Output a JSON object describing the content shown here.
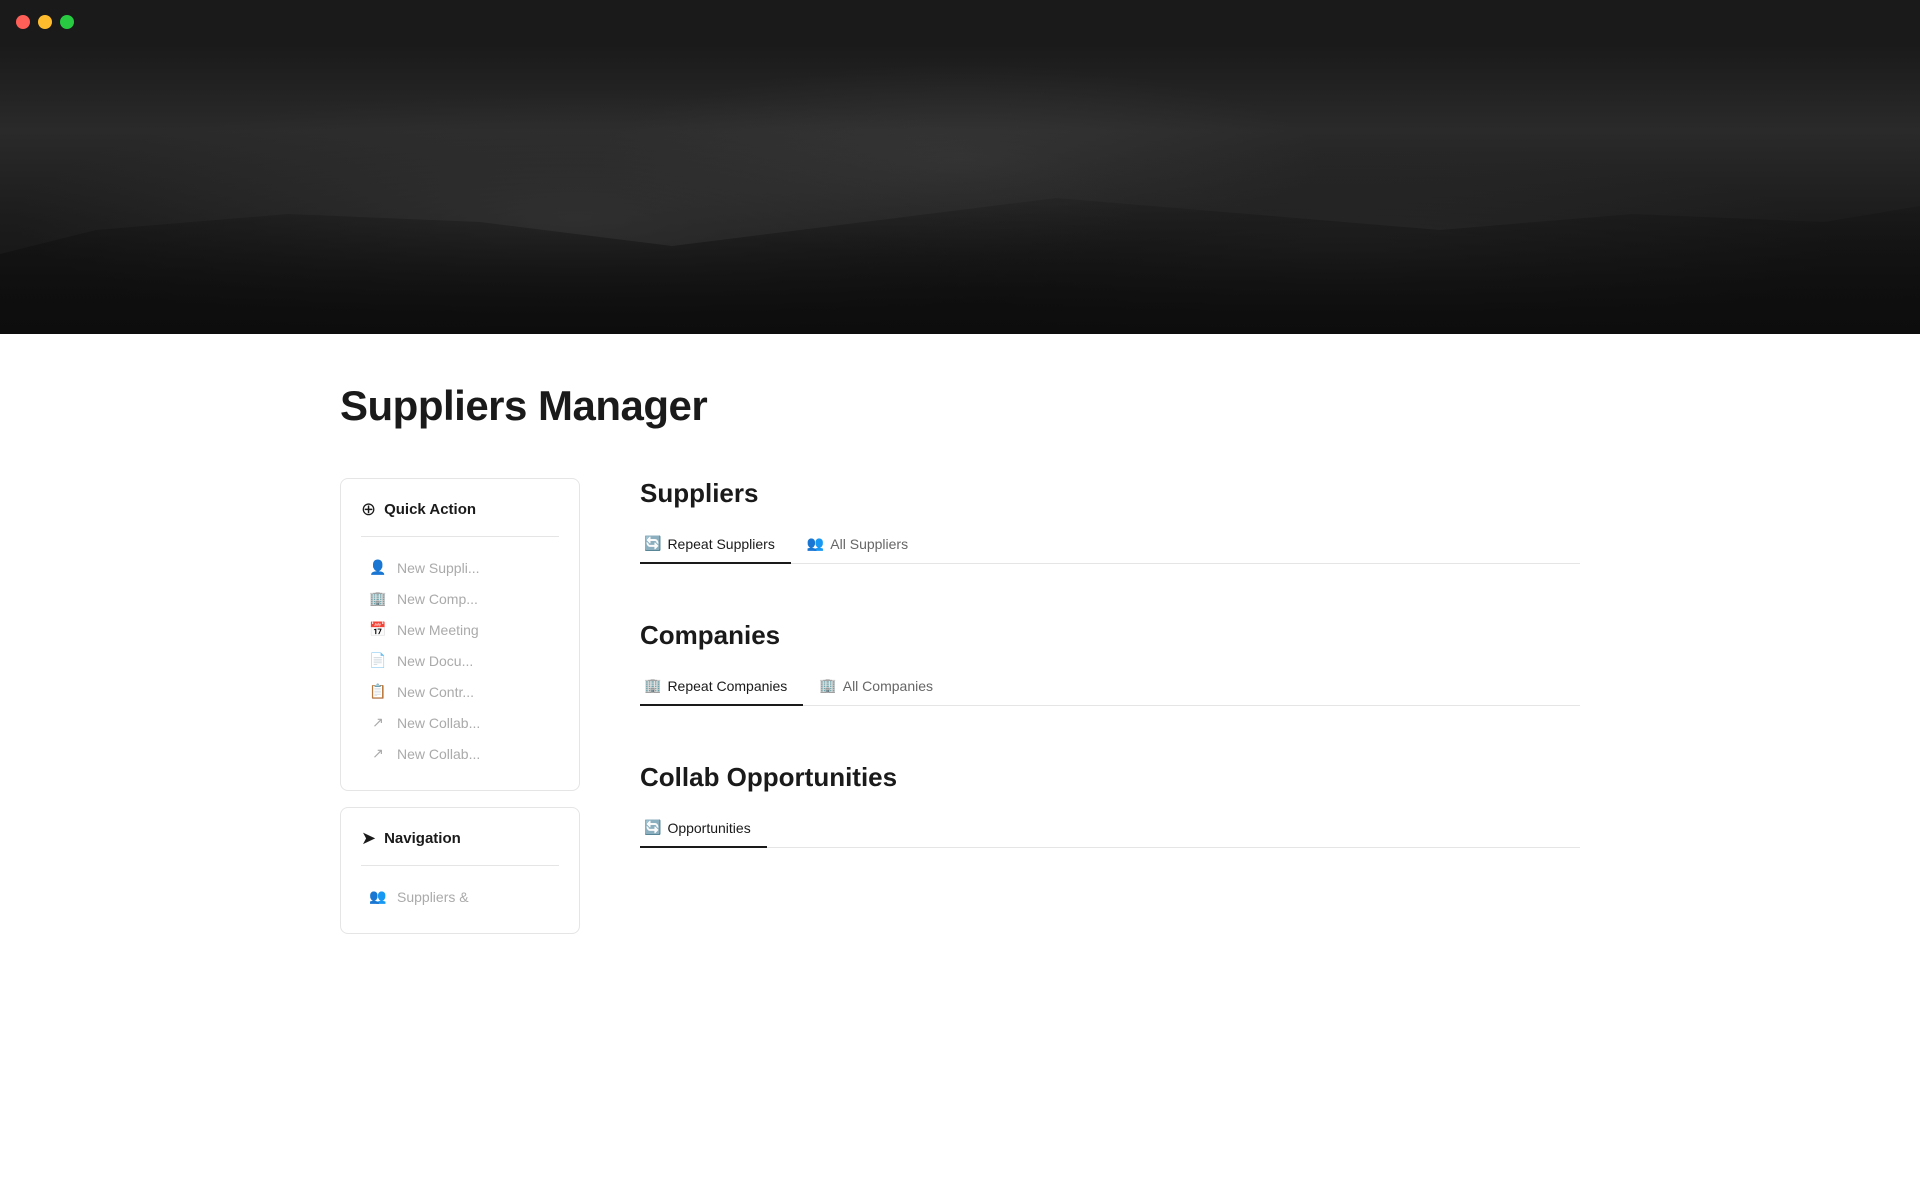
{
  "titlebar": {
    "traffic_lights": [
      "red",
      "yellow",
      "green"
    ]
  },
  "page": {
    "title": "Suppliers Manager"
  },
  "sidebar": {
    "quick_action": {
      "header_icon": "⊕",
      "header_label": "Quick Action",
      "items": [
        {
          "icon": "👤",
          "label": "New Suppli..."
        },
        {
          "icon": "🏢",
          "label": "New Comp..."
        },
        {
          "icon": "📅",
          "label": "New Meeting"
        },
        {
          "icon": "📄",
          "label": "New Docu..."
        },
        {
          "icon": "📋",
          "label": "New Contr..."
        },
        {
          "icon": "↗",
          "label": "New Collab..."
        },
        {
          "icon": "↗",
          "label": "New Collab..."
        }
      ]
    },
    "navigation": {
      "header_icon": "➤",
      "header_label": "Navigation",
      "items": [
        {
          "icon": "👥",
          "label": "Suppliers &"
        }
      ]
    }
  },
  "sections": {
    "suppliers": {
      "title": "Suppliers",
      "tabs": [
        {
          "id": "repeat-suppliers",
          "icon": "🔄",
          "label": "Repeat Suppliers",
          "active": true
        },
        {
          "id": "all-suppliers",
          "icon": "👥",
          "label": "All Suppliers",
          "active": false
        }
      ]
    },
    "companies": {
      "title": "Companies",
      "tabs": [
        {
          "id": "repeat-companies",
          "icon": "🏢",
          "label": "Repeat Companies",
          "active": true
        },
        {
          "id": "all-companies",
          "icon": "🏢",
          "label": "All Companies",
          "active": false
        }
      ]
    },
    "collab": {
      "title": "Collab Opportunities",
      "tabs": [
        {
          "id": "opportunities",
          "icon": "🔄",
          "label": "Opportunities",
          "active": true
        }
      ]
    }
  }
}
